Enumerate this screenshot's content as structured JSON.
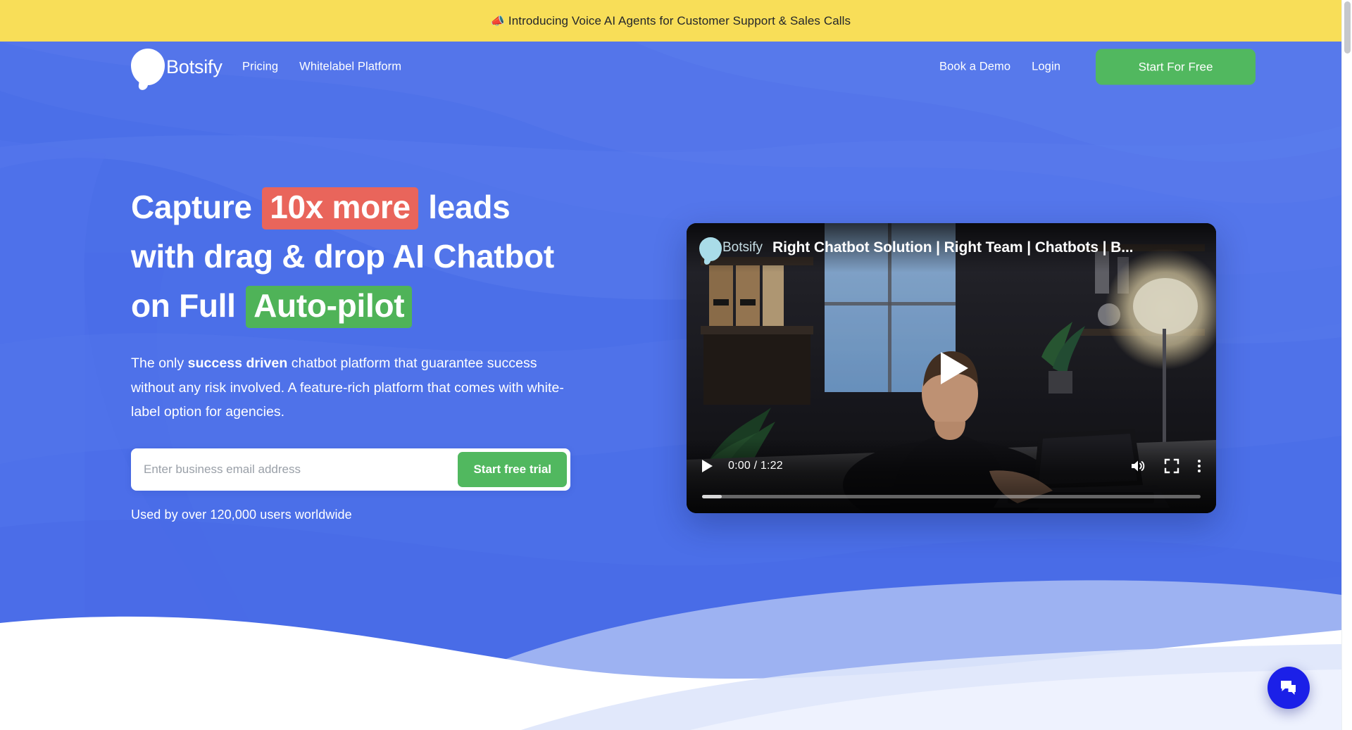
{
  "announcement": {
    "emoji": "📣",
    "text": "Introducing Voice AI Agents for Customer Support & Sales Calls",
    "background": "#F8DE58"
  },
  "header": {
    "brand_name": "Botsify",
    "nav_left": [
      {
        "label": "Pricing"
      },
      {
        "label": "Whitelabel Platform"
      }
    ],
    "nav_right": [
      {
        "label": "Book a Demo"
      },
      {
        "label": "Login"
      }
    ],
    "cta_label": "Start For Free",
    "cta_color": "#51B85F"
  },
  "hero": {
    "headline": {
      "line1_before": "Capture",
      "line1_highlight": "10x more",
      "line1_after": "leads",
      "line2": "with drag & drop AI Chatbot",
      "line3_before": "on Full",
      "line3_highlight": "Auto-pilot"
    },
    "highlight_red": "#E9655B",
    "highlight_green": "#4FB358",
    "subhead_part1": "The only ",
    "subhead_bold": "success driven",
    "subhead_part2": " chatbot platform that guarantee success without any risk involved. A feature-rich platform that comes with white-label option for agencies.",
    "form": {
      "email_placeholder": "Enter business email address",
      "email_value": "",
      "submit_label": "Start free trial"
    },
    "users_note": "Used by over 120,000 users worldwide",
    "background": "#4B6FE8"
  },
  "video": {
    "channel_name": "Botsify",
    "title": "Right Chatbot Solution | Right Team | Chatbots | B...",
    "current_time": "0:00",
    "duration": "1:22",
    "time_display": "0:00 / 1:22",
    "progress_percent": 4,
    "controls": {
      "play": "play-icon",
      "mute": "volume-icon",
      "fullscreen": "fullscreen-icon",
      "more": "more-options-icon"
    }
  },
  "chat_widget": {
    "icon": "chat-bubbles-icon",
    "color": "#1B20E8"
  }
}
